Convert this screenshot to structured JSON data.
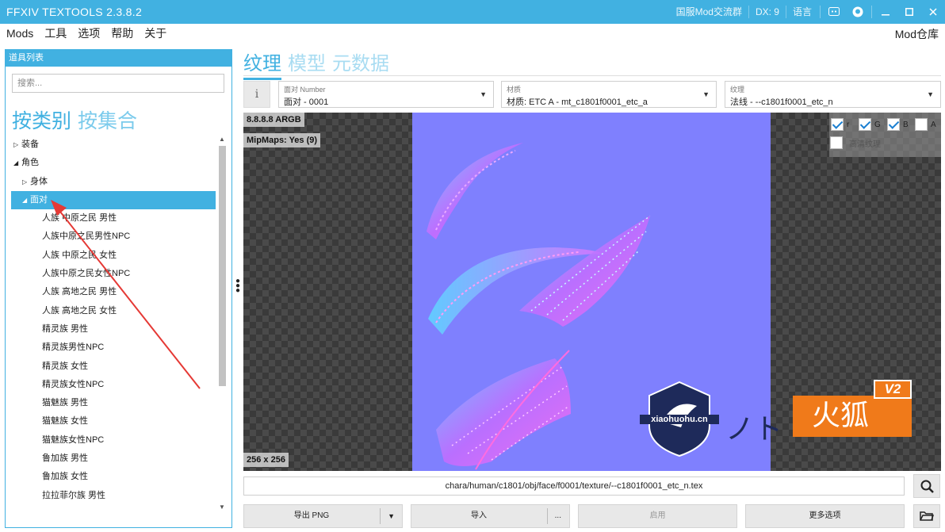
{
  "titlebar": {
    "title": "FFXIV TEXTOOLS 2.3.8.2",
    "server_group": "国服Mod交流群",
    "dx": "DX: 9",
    "language": "语言"
  },
  "menu": {
    "items": [
      "Mods",
      "工具",
      "选项",
      "帮助",
      "关于"
    ],
    "mod_repo": "Mod仓库"
  },
  "left": {
    "header": "道具列表",
    "search_placeholder": "搜索...",
    "tab_category": "按类别",
    "tab_set": "按集合",
    "tree": [
      {
        "label": "装备",
        "level": 0,
        "arrow": "▷"
      },
      {
        "label": "角色",
        "level": 0,
        "arrow": "◢"
      },
      {
        "label": "身体",
        "level": 1,
        "arrow": "▷"
      },
      {
        "label": "面对",
        "level": 1,
        "arrow": "◢",
        "selected": true
      },
      {
        "label": "人族 中原之民 男性",
        "level": 2
      },
      {
        "label": "人族中原之民男性NPC",
        "level": 2
      },
      {
        "label": "人族 中原之民 女性",
        "level": 2
      },
      {
        "label": "人族中原之民女性NPC",
        "level": 2
      },
      {
        "label": "人族 高地之民 男性",
        "level": 2
      },
      {
        "label": "人族 高地之民 女性",
        "level": 2
      },
      {
        "label": "精灵族 男性",
        "level": 2
      },
      {
        "label": "精灵族男性NPC",
        "level": 2
      },
      {
        "label": "精灵族 女性",
        "level": 2
      },
      {
        "label": "精灵族女性NPC",
        "level": 2
      },
      {
        "label": "猫魅族 男性",
        "level": 2
      },
      {
        "label": "猫魅族 女性",
        "level": 2
      },
      {
        "label": "猫魅族女性NPC",
        "level": 2
      },
      {
        "label": "鲁加族 男性",
        "level": 2
      },
      {
        "label": "鲁加族 女性",
        "level": 2
      },
      {
        "label": "拉拉菲尔族 男性",
        "level": 2
      }
    ]
  },
  "main": {
    "tabs": [
      "纹理",
      "模型",
      "元数据"
    ],
    "active_tab": 0,
    "info_label": "i",
    "face_label": "面对 Number",
    "face_value": "面对 - 0001",
    "material_label": "材质",
    "material_value": "材质: ETC A - mt_c1801f0001_etc_a",
    "texture_label": "纹理",
    "texture_value": "法线 - --c1801f0001_etc_n",
    "format": "8.8.8.8  ARGB",
    "mipmaps": "MipMaps: Yes (9)",
    "resolution": "256 x 256",
    "channels": {
      "r": "r",
      "g": "G",
      "b": "B",
      "a": "A",
      "r_checked": true,
      "g_checked": true,
      "b_checked": true,
      "a_checked": false
    },
    "hd_texture": "高清纹理",
    "path": "chara/human/c1801/obj/face/f0001/texture/--c1801f0001_etc_n.tex",
    "buttons": {
      "export": "导出 PNG",
      "import": "导入",
      "import_more": "...",
      "enable": "启用",
      "more_options": "更多选项"
    }
  },
  "watermark": {
    "site": "xiaohuohu.cn",
    "brand": "火狐",
    "version": "V2"
  },
  "colors": {
    "accent": "#41b1e1",
    "texture_bg": "#7f80fe"
  }
}
